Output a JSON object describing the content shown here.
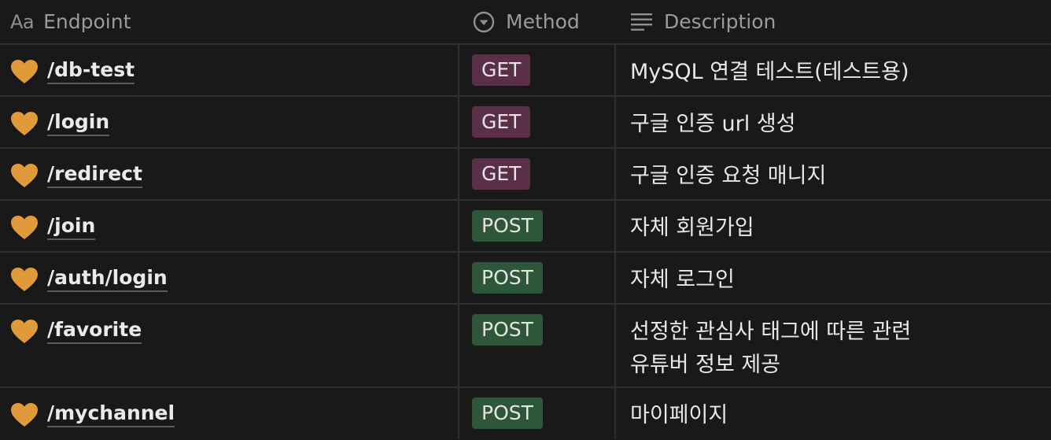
{
  "header": {
    "endpoint_label": "Endpoint",
    "endpoint_icon_text": "Aa",
    "method_label": "Method",
    "description_label": "Description"
  },
  "colors": {
    "background": "#191919",
    "get_badge": "#5c2f49",
    "post_badge": "#2e5638",
    "heart": "#e09a3a"
  },
  "rows": [
    {
      "icon": "orange-heart-icon",
      "endpoint": "/db-test",
      "method": "GET",
      "description_line1": "MySQL 연결 테스트(테스트용)",
      "description_line2": ""
    },
    {
      "icon": "orange-heart-icon",
      "endpoint": "/login",
      "method": "GET",
      "description_line1": "구글 인증 url 생성",
      "description_line2": ""
    },
    {
      "icon": "orange-heart-icon",
      "endpoint": "/redirect",
      "method": "GET",
      "description_line1": "구글 인증 요청 매니지",
      "description_line2": ""
    },
    {
      "icon": "orange-heart-icon",
      "endpoint": "/join",
      "method": "POST",
      "description_line1": "자체 회원가입",
      "description_line2": ""
    },
    {
      "icon": "orange-heart-icon",
      "endpoint": "/auth/login",
      "method": "POST",
      "description_line1": "자체 로그인",
      "description_line2": ""
    },
    {
      "icon": "orange-heart-icon",
      "endpoint": "/favorite",
      "method": "POST",
      "description_line1": "선정한 관심사 태그에 따른 관련",
      "description_line2": "유튜버 정보 제공"
    },
    {
      "icon": "orange-heart-icon",
      "endpoint": "/mychannel",
      "method": "POST",
      "description_line1": "마이페이지",
      "description_line2": ""
    }
  ]
}
